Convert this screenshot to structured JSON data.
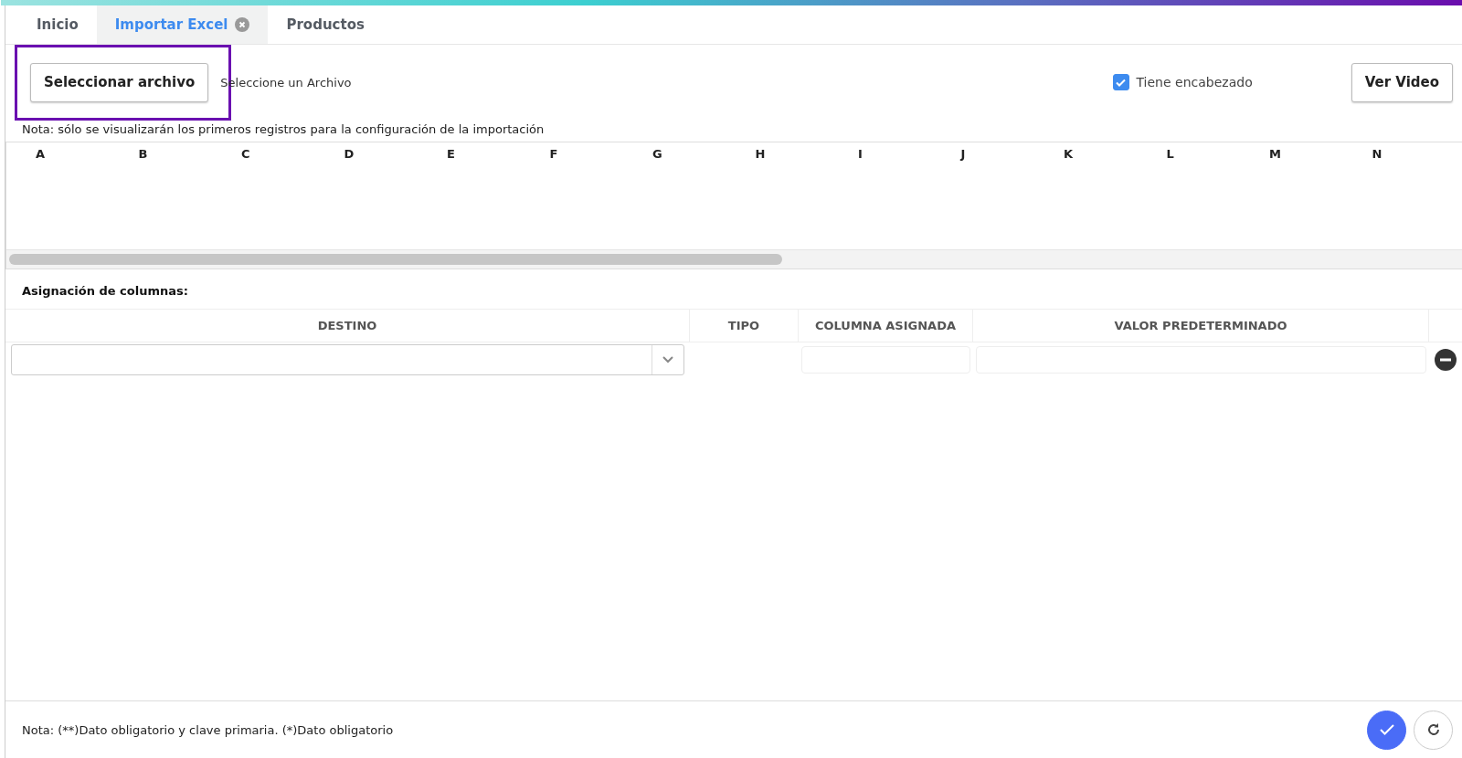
{
  "tabs": [
    {
      "label": "Inicio",
      "selected": false,
      "closable": false
    },
    {
      "label": "Importar Excel",
      "selected": true,
      "closable": true
    },
    {
      "label": "Productos",
      "selected": false,
      "closable": false
    }
  ],
  "toolbar": {
    "file_button": "Seleccionar archivo",
    "file_status": "Seleccione un Archivo",
    "header_checkbox": {
      "label": "Tiene encabezado",
      "checked": true
    },
    "video_button": "Ver Video"
  },
  "preview_note": "Nota: sólo se visualizarán los primeros registros para la configuración de la importación",
  "preview_columns": [
    "A",
    "B",
    "C",
    "D",
    "E",
    "F",
    "G",
    "H",
    "I",
    "J",
    "K",
    "L",
    "M",
    "N"
  ],
  "mapping": {
    "title": "Asignación de columnas:",
    "columns": [
      "DESTINO",
      "TIPO",
      "COLUMNA ASIGNADA",
      "VALOR PREDETERMINADO"
    ]
  },
  "footer": {
    "note": "Nota: (**)Dato obligatorio y clave primaria. (*)Dato obligatorio"
  }
}
